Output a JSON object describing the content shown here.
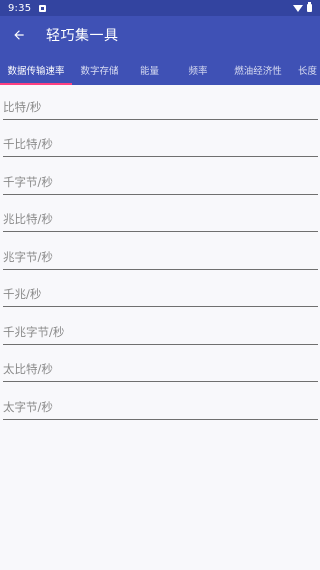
{
  "status": {
    "time": "9:35"
  },
  "app_bar": {
    "title": "轻巧集一具"
  },
  "tabs": [
    {
      "label": "数据传输速率",
      "active": true
    },
    {
      "label": "数字存储",
      "active": false
    },
    {
      "label": "能量",
      "active": false
    },
    {
      "label": "频率",
      "active": false
    },
    {
      "label": "燃油经济性",
      "active": false
    },
    {
      "label": "长度",
      "active": false
    }
  ],
  "fields": [
    {
      "placeholder": "比特/秒",
      "value": ""
    },
    {
      "placeholder": "千比特/秒",
      "value": ""
    },
    {
      "placeholder": "千字节/秒",
      "value": ""
    },
    {
      "placeholder": "兆比特/秒",
      "value": ""
    },
    {
      "placeholder": "兆字节/秒",
      "value": ""
    },
    {
      "placeholder": "千兆/秒",
      "value": ""
    },
    {
      "placeholder": "千兆字节/秒",
      "value": ""
    },
    {
      "placeholder": "太比特/秒",
      "value": ""
    },
    {
      "placeholder": "太字节/秒",
      "value": ""
    }
  ],
  "colors": {
    "primary": "#3f51b5",
    "primary_dark": "#3344a0",
    "accent": "#ff4081"
  }
}
